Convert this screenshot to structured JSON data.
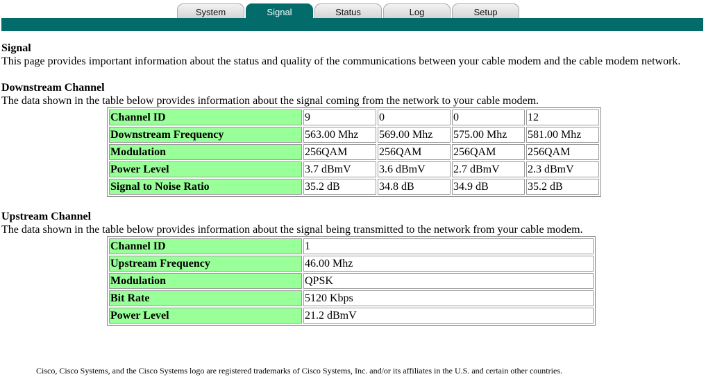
{
  "tabs": [
    {
      "label": "System",
      "active": false
    },
    {
      "label": "Signal",
      "active": true
    },
    {
      "label": "Status",
      "active": false
    },
    {
      "label": "Log",
      "active": false
    },
    {
      "label": "Setup",
      "active": false
    }
  ],
  "accent_color": "#036b6a",
  "label_cell_color": "#99ff99",
  "page": {
    "title": "Signal",
    "description": "This page provides important information about the status and quality of the communications between your cable modem and the cable modem network."
  },
  "downstream": {
    "title": "Downstream Channel",
    "description": "The data shown in the table below provides information about the signal coming from the network to your cable modem.",
    "rows": [
      {
        "label": "Channel ID",
        "values": [
          "9",
          "0",
          "0",
          "12"
        ]
      },
      {
        "label": "Downstream Frequency",
        "values": [
          "563.00 Mhz",
          "569.00 Mhz",
          "575.00 Mhz",
          "581.00 Mhz"
        ]
      },
      {
        "label": "Modulation",
        "values": [
          "256QAM",
          "256QAM",
          "256QAM",
          "256QAM"
        ]
      },
      {
        "label": "Power Level",
        "values": [
          "3.7 dBmV",
          "3.6 dBmV",
          "2.7 dBmV",
          "2.3 dBmV"
        ]
      },
      {
        "label": "Signal to Noise Ratio",
        "values": [
          "35.2 dB",
          "34.8 dB",
          "34.9 dB",
          "35.2 dB"
        ]
      }
    ]
  },
  "upstream": {
    "title": "Upstream Channel",
    "description": "The data shown in the table below provides information about the signal being transmitted to the network from your cable modem.",
    "rows": [
      {
        "label": "Channel ID",
        "value": "1"
      },
      {
        "label": "Upstream Frequency",
        "value": "46.00 Mhz"
      },
      {
        "label": "Modulation",
        "value": "QPSK"
      },
      {
        "label": "Bit Rate",
        "value": "5120 Kbps"
      },
      {
        "label": "Power Level",
        "value": "21.2 dBmV"
      }
    ]
  },
  "footer": "Cisco, Cisco Systems, and the Cisco Systems logo are registered trademarks of Cisco Systems, Inc. and/or its affiliates in the U.S. and certain other countries."
}
